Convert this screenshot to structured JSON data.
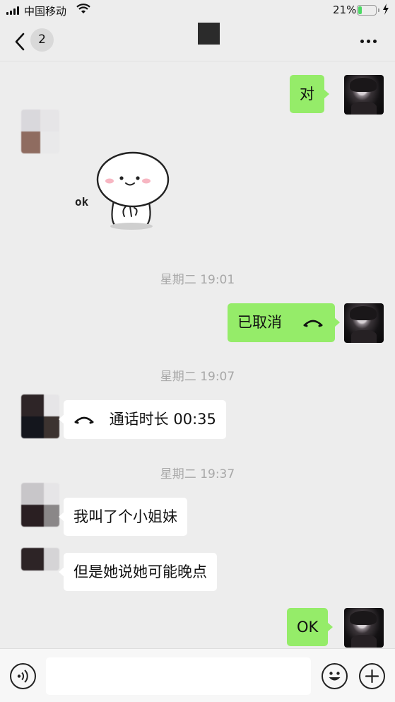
{
  "status_bar": {
    "carrier": "中国移动",
    "battery_percent": "21%",
    "battery_level": 0.21,
    "icons": [
      "signal-icon",
      "wifi-icon",
      "battery-icon",
      "charging-bolt-icon"
    ]
  },
  "nav": {
    "unread_count": "2",
    "icons": [
      "back-arrow-icon",
      "more-dots-icon"
    ]
  },
  "messages": {
    "m1_text": "对",
    "m2_sticker_caption": "ok",
    "ts1": "星期二 19:01",
    "m3_text": "已取消",
    "ts2": "星期二 19:07",
    "m4_text": "通话时长 00:35",
    "ts3": "星期二 19:37",
    "m5_text": "我叫了个小姐妹",
    "m6_text": "但是她说她可能晚点",
    "m7_text": "OK"
  },
  "input_bar": {
    "placeholder": "",
    "icons": [
      "voice-icon",
      "emoji-icon",
      "plus-icon"
    ]
  },
  "colors": {
    "background": "#ededed",
    "bubble_self": "#95ec69",
    "bubble_other": "#ffffff",
    "timestamp": "#a8a8a8",
    "battery_fill": "#4cd964"
  }
}
